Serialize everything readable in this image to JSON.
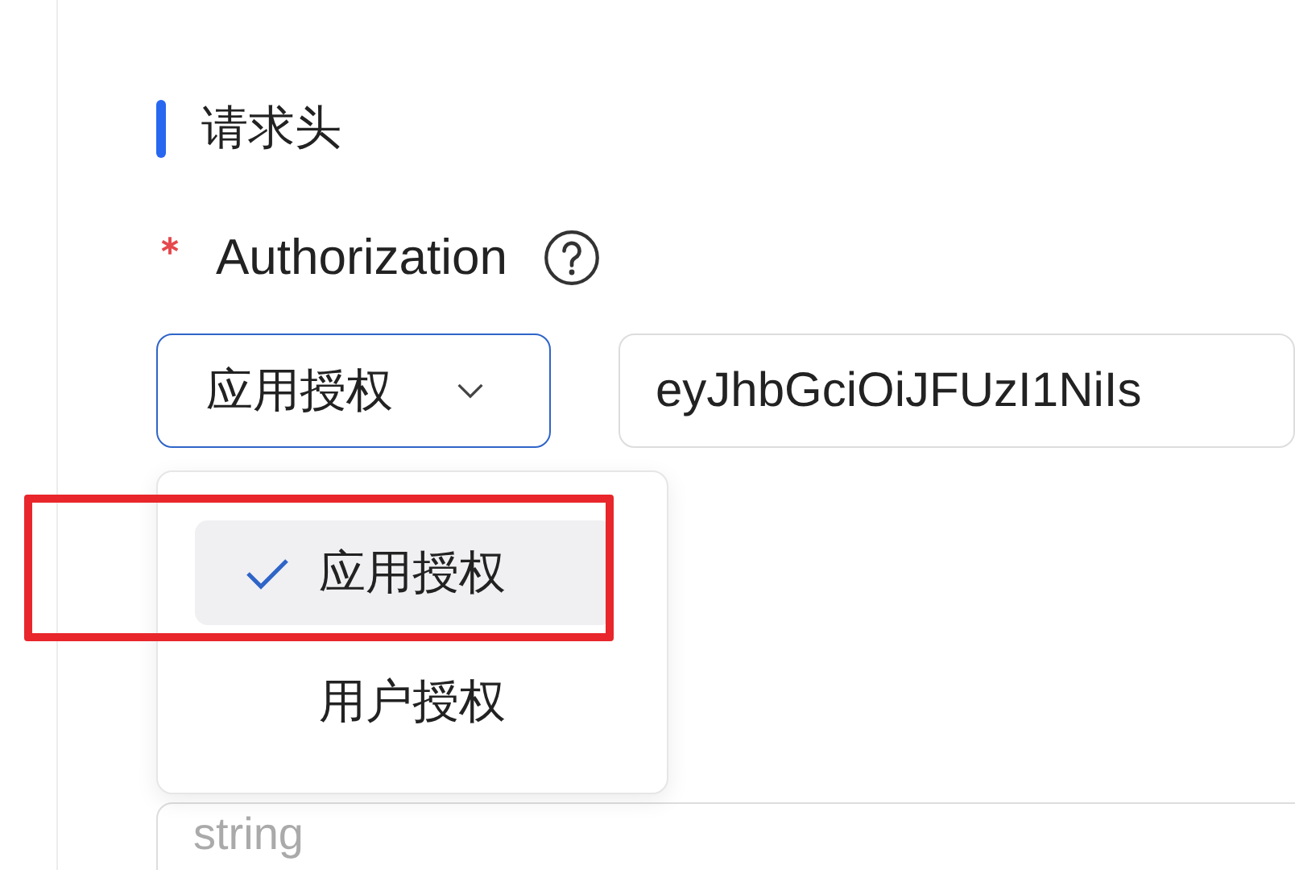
{
  "section": {
    "title": "请求头"
  },
  "field": {
    "label": "Authorization",
    "required": true
  },
  "select": {
    "value": "应用授权",
    "open": true
  },
  "token": {
    "value": "eyJhbGciOiJFUzI1NiIs"
  },
  "menu": [
    {
      "label": "应用授权",
      "selected": true
    },
    {
      "label": "用户授权",
      "selected": false
    }
  ],
  "next_field": {
    "placeholder": "string"
  }
}
